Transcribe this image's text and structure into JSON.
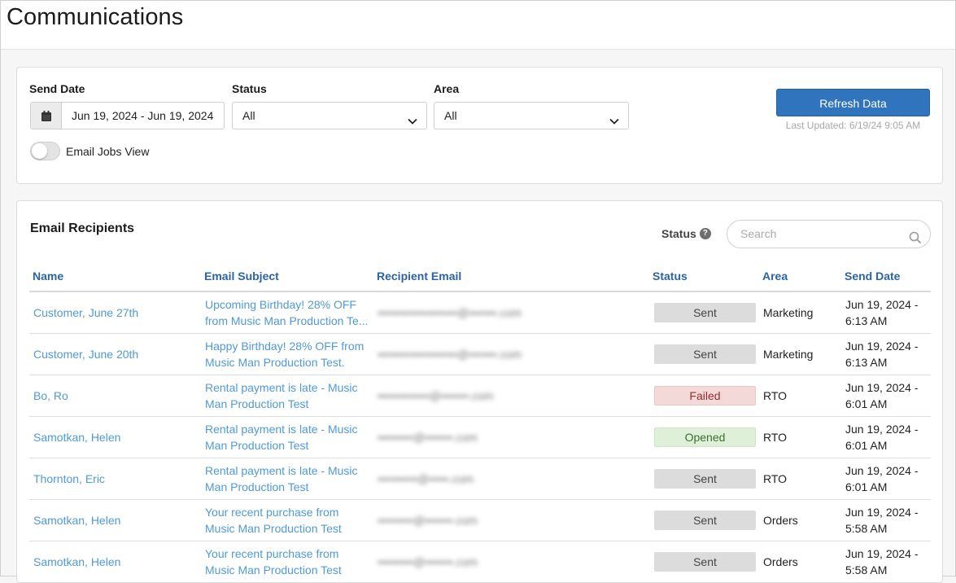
{
  "page": {
    "title": "Communications"
  },
  "filters": {
    "send_date": {
      "label": "Send Date",
      "value": "Jun 19, 2024 - Jun 19, 2024"
    },
    "status": {
      "label": "Status",
      "value": "All"
    },
    "area": {
      "label": "Area",
      "value": "All"
    },
    "email_jobs_view": {
      "label": "Email Jobs View",
      "enabled": false
    },
    "refresh_label": "Refresh Data",
    "last_updated": "Last Updated: 6/19/24 9:05 AM"
  },
  "recipients": {
    "title": "Email Recipients",
    "status_filter_label": "Status",
    "search_placeholder": "Search",
    "columns": [
      "Name",
      "Email Subject",
      "Recipient Email",
      "Status",
      "Area",
      "Send Date"
    ],
    "rows": [
      {
        "name": "Customer, June 27th",
        "subject": "Upcoming Birthday! 28% OFF from Music Man Production Te...",
        "email": "••••••••••••••••••••@•••••••.com",
        "status": "Sent",
        "status_kind": "sent",
        "area": "Marketing",
        "send_date": "Jun 19, 2024 - 6:13 AM"
      },
      {
        "name": "Customer, June 20th",
        "subject": "Happy Birthday! 28% OFF from Music Man Production Test.",
        "email": "••••••••••••••••••••@•••••••.com",
        "status": "Sent",
        "status_kind": "sent",
        "area": "Marketing",
        "send_date": "Jun 19, 2024 - 6:13 AM"
      },
      {
        "name": "Bo, Ro",
        "subject": "Rental payment is late - Music Man Production Test",
        "email": "•••••••••••••@•••••••.com",
        "status": "Failed",
        "status_kind": "failed",
        "area": "RTO",
        "send_date": "Jun 19, 2024 - 6:01 AM"
      },
      {
        "name": "Samotkan, Helen",
        "subject": "Rental payment is late - Music Man Production Test",
        "email": "•••••••••@•••••••.com",
        "status": "Opened",
        "status_kind": "opened",
        "area": "RTO",
        "send_date": "Jun 19, 2024 - 6:01 AM"
      },
      {
        "name": "Thornton, Eric",
        "subject": "Rental payment is late - Music Man Production Test",
        "email": "••••••••••@•••••.com",
        "status": "Sent",
        "status_kind": "sent",
        "area": "RTO",
        "send_date": "Jun 19, 2024 - 6:01 AM"
      },
      {
        "name": "Samotkan, Helen",
        "subject": "Your recent purchase from Music Man Production Test",
        "email": "•••••••••@•••••••.com",
        "status": "Sent",
        "status_kind": "sent",
        "area": "Orders",
        "send_date": "Jun 19, 2024 - 5:58 AM"
      },
      {
        "name": "Samotkan, Helen",
        "subject": "Your recent purchase from Music Man Production Test",
        "email": "•••••••••@•••••••.com",
        "status": "Sent",
        "status_kind": "sent",
        "area": "Orders",
        "send_date": "Jun 19, 2024 - 5:58 AM"
      }
    ]
  }
}
